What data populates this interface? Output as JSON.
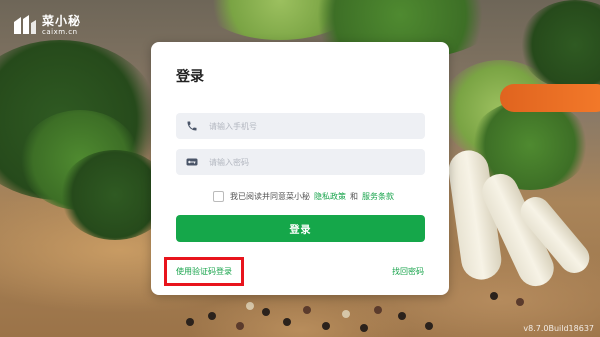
{
  "brand": {
    "name": "菜小秘",
    "domain": "caixm.cn",
    "logo_icon": "caixm-logo-icon"
  },
  "login": {
    "title": "登录",
    "phone": {
      "placeholder": "请输入手机号",
      "value": "",
      "icon": "phone-icon"
    },
    "password": {
      "placeholder": "请输入密码",
      "value": "",
      "icon": "key-icon"
    },
    "agreement": {
      "checked": false,
      "prefix": "我已阅读并同意菜小秘",
      "privacy_link": "隐私政策",
      "and": "和",
      "terms_link": "服务条款"
    },
    "submit_label": "登录",
    "code_login_label": "使用验证码登录",
    "forgot_label": "找回密码"
  },
  "version": "v8.7.0Build18637",
  "colors": {
    "accent": "#15a74a",
    "highlight": "#e8141c",
    "input_bg": "#eef0f4"
  }
}
